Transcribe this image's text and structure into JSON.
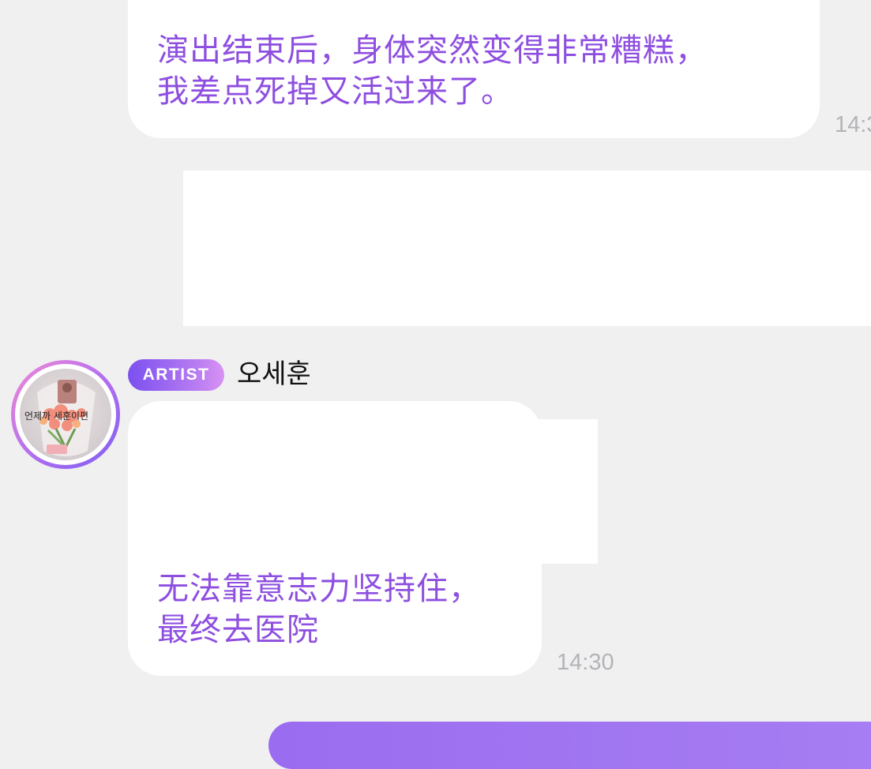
{
  "messages": {
    "first": {
      "text": "演出结束后，身体突然变得非常糟糕，\n我差点死掉又活过来了。",
      "time": "14:3"
    },
    "second": {
      "text": "无法靠意志力坚持住，\n最终去医院",
      "time": "14:30"
    }
  },
  "sender": {
    "badge": "ARTIST",
    "name": "오세훈"
  },
  "avatar": {
    "caption": "언제까 세훈이편"
  },
  "colors": {
    "background": "#f0f0f1",
    "message_text": "#8e4fe0",
    "timestamp": "#b3b3b8",
    "badge_start": "#7b50f0",
    "badge_end": "#d892f3",
    "outgoing": "#9a6cf0"
  }
}
